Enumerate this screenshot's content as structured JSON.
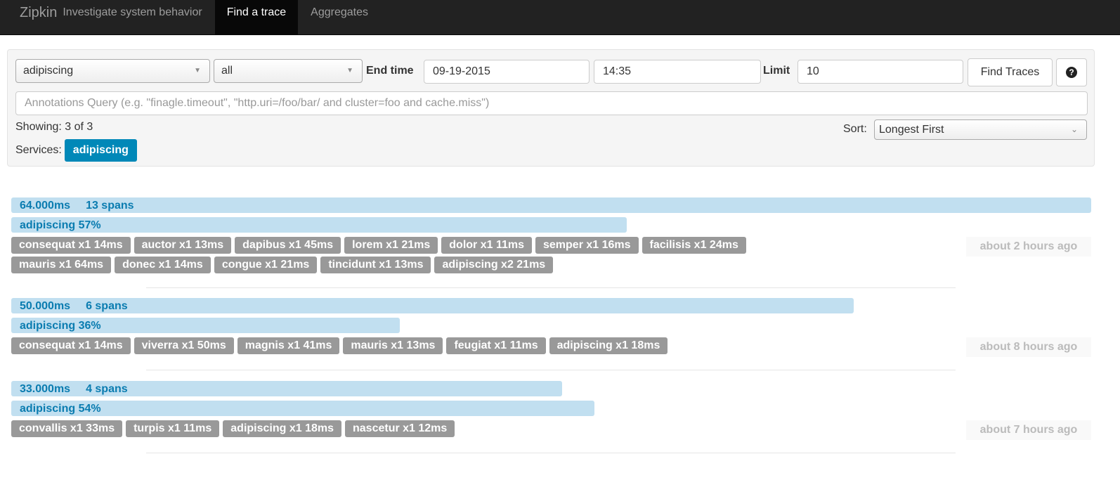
{
  "nav": {
    "brand": "Zipkin",
    "tagline": "Investigate system behavior",
    "tabs": [
      {
        "label": "Find a trace",
        "active": true
      },
      {
        "label": "Aggregates"
      }
    ]
  },
  "search": {
    "service": "adipiscing",
    "span": "all",
    "end_time_label": "End time",
    "date": "09-19-2015",
    "time": "14:35",
    "limit_label": "Limit",
    "limit": "10",
    "find_button": "Find Traces",
    "help_icon": "question-circle-icon",
    "annotations_placeholder": "Annotations Query (e.g. \"finagle.timeout\", \"http.uri=/foo/bar/ and cluster=foo and cache.miss\")",
    "showing": "Showing: 3 of 3",
    "services_label": "Services:",
    "services": [
      "adipiscing"
    ],
    "sort_label": "Sort:",
    "sort": "Longest First"
  },
  "colors": {
    "accent": "#0088b8",
    "bar": "#c1dff0",
    "tag": "#999999"
  },
  "traces": [
    {
      "duration": "64.000ms",
      "spans": "13 spans",
      "width_pct": 100,
      "service": "adipiscing 57%",
      "service_pct": 57,
      "ago": "about 2 hours ago",
      "tags": [
        "consequat x1 14ms",
        "auctor x1 13ms",
        "dapibus x1 45ms",
        "lorem x1 21ms",
        "dolor x1 11ms",
        "semper x1 16ms",
        "facilisis x1 24ms",
        "mauris x1 64ms",
        "donec x1 14ms",
        "congue x1 21ms",
        "tincidunt x1 13ms",
        "adipiscing x2 21ms"
      ]
    },
    {
      "duration": "50.000ms",
      "spans": "6 spans",
      "width_pct": 78,
      "service": "adipiscing 36%",
      "service_pct": 36,
      "ago": "about 8 hours ago",
      "tags": [
        "consequat x1 14ms",
        "viverra x1 50ms",
        "magnis x1 41ms",
        "mauris x1 13ms",
        "feugiat x1 11ms",
        "adipiscing x1 18ms"
      ]
    },
    {
      "duration": "33.000ms",
      "spans": "4 spans",
      "width_pct": 51,
      "service": "adipiscing 54%",
      "service_pct": 54,
      "ago": "about 7 hours ago",
      "tags": [
        "convallis x1 33ms",
        "turpis x1 11ms",
        "adipiscing x1 18ms",
        "nascetur x1 12ms"
      ]
    }
  ]
}
